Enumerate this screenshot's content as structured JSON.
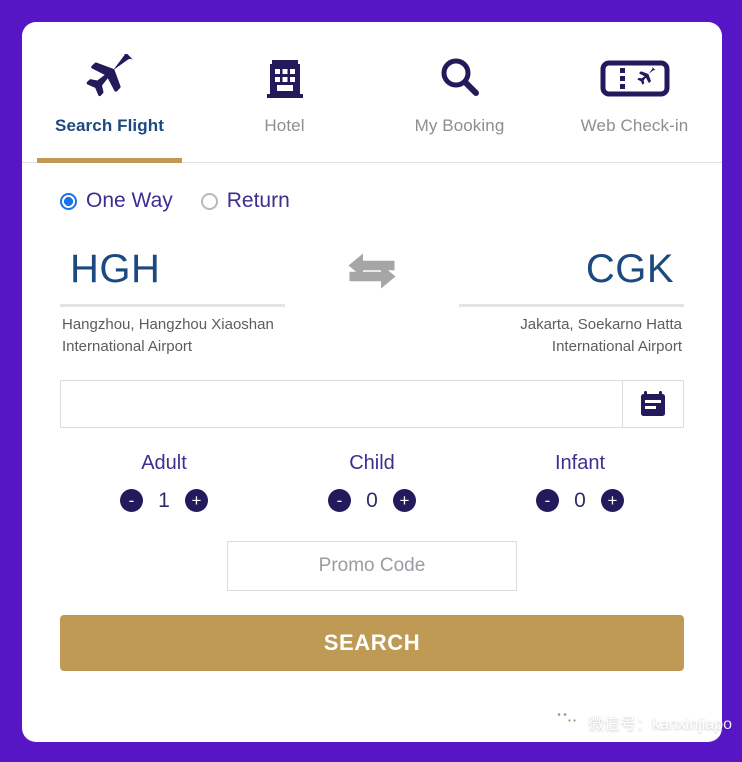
{
  "theme": {
    "page_background": "#5716c6",
    "card_background": "#ffffff",
    "accent_gold": "#bf9a55",
    "navy": "#231a5c",
    "active_tab_text": "#1c4a80",
    "inactive_tab_text": "#8d8d93",
    "radio_selected": "#1a73e8",
    "label_purple": "#3b2f8f"
  },
  "tabs": [
    {
      "id": "search-flight",
      "label": "Search Flight",
      "icon": "airplane-icon",
      "active": true
    },
    {
      "id": "hotel",
      "label": "Hotel",
      "icon": "building-icon",
      "active": false
    },
    {
      "id": "my-booking",
      "label": "My Booking",
      "icon": "magnifier-icon",
      "active": false
    },
    {
      "id": "web-check-in",
      "label": "Web Check-in",
      "icon": "boarding-pass-icon",
      "active": false
    }
  ],
  "trip_type": {
    "options": [
      {
        "id": "one-way",
        "label": "One Way",
        "selected": true
      },
      {
        "id": "return",
        "label": "Return",
        "selected": false
      }
    ]
  },
  "route": {
    "from": {
      "code": "HGH",
      "name": "Hangzhou, Hangzhou Xiaoshan International Airport"
    },
    "swap_icon": "swap-arrows-icon",
    "to": {
      "code": "CGK",
      "name": "Jakarta, Soekarno Hatta International Airport"
    }
  },
  "date": {
    "value": "",
    "placeholder": "",
    "calendar_icon": "calendar-icon"
  },
  "passengers": [
    {
      "id": "adult",
      "label": "Adult",
      "value": "1",
      "decrement": "-",
      "increment": "+"
    },
    {
      "id": "child",
      "label": "Child",
      "value": "0",
      "decrement": "-",
      "increment": "+"
    },
    {
      "id": "infant",
      "label": "Infant",
      "value": "0",
      "decrement": "-",
      "increment": "+"
    }
  ],
  "promo": {
    "value": "",
    "placeholder": "Promo Code"
  },
  "search_button": {
    "label": "SEARCH"
  },
  "watermark": {
    "icon": "wechat-icon",
    "text": "微信号：kanxinjiapo"
  }
}
